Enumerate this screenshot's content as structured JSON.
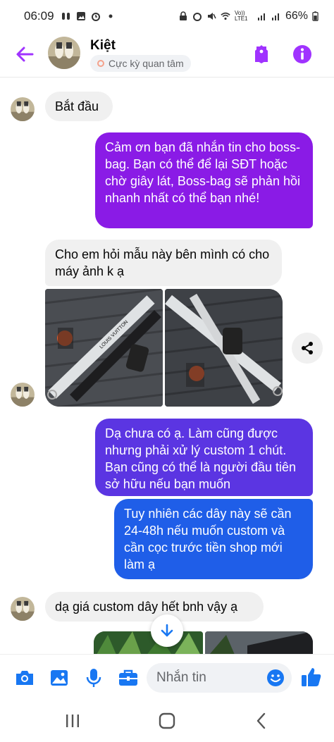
{
  "status_bar": {
    "time": "06:09",
    "network": "Vo)) LTE1",
    "battery": "66%"
  },
  "header": {
    "contact_name": "Kiệt",
    "contact_label": "Cực kỳ quan tâm",
    "accent_color": "#a033ff"
  },
  "messages": [
    {
      "from": "contact",
      "text": "Bắt đầu"
    },
    {
      "from": "me",
      "text": "Cảm ơn bạn đã nhắn tin cho boss-bag. Bạn có thể để lại SĐT hoặc chờ giây lát, Boss-bag sẽ phản hồi nhanh nhất có thể bạn nhé!"
    },
    {
      "from": "contact",
      "text": "Cho em hỏi mẫu này bên mình có cho máy ảnh k ạ"
    },
    {
      "from": "contact",
      "type": "photos",
      "count": 2
    },
    {
      "from": "me",
      "text": "Dạ chưa có ạ. Làm cũng được nhưng phải xử lý custom 1 chút. Bạn cũng có thể là người đầu tiên sở hữu nếu bạn muốn"
    },
    {
      "from": "me",
      "text": "Tuy nhiên các dây này sẽ cần 24-48h nếu muốn custom và cần cọc trước tiền shop mới làm ạ"
    },
    {
      "from": "contact",
      "text": "dạ giá custom dây hết bnh vậy ạ"
    }
  ],
  "photo_text": {
    "brand": "LOUIS VUITTON"
  },
  "composer": {
    "placeholder": "Nhắn tin"
  },
  "colors": {
    "bubble_in": "#f0f0f0",
    "bubble_out_purple": "#8a1be6",
    "bubble_out_violet": "#5b35e2",
    "bubble_out_blue": "#1f5ee8",
    "icon_blue": "#1877f2"
  },
  "icons": {
    "back": "arrow-left-icon",
    "tag": "tag-icon",
    "info": "info-icon",
    "share": "share-icon",
    "scroll": "arrow-down-icon",
    "camera": "camera-icon",
    "gallery": "image-icon",
    "mic": "microphone-icon",
    "briefcase": "briefcase-icon",
    "emoji": "emoji-icon",
    "like": "thumbs-up-icon"
  }
}
